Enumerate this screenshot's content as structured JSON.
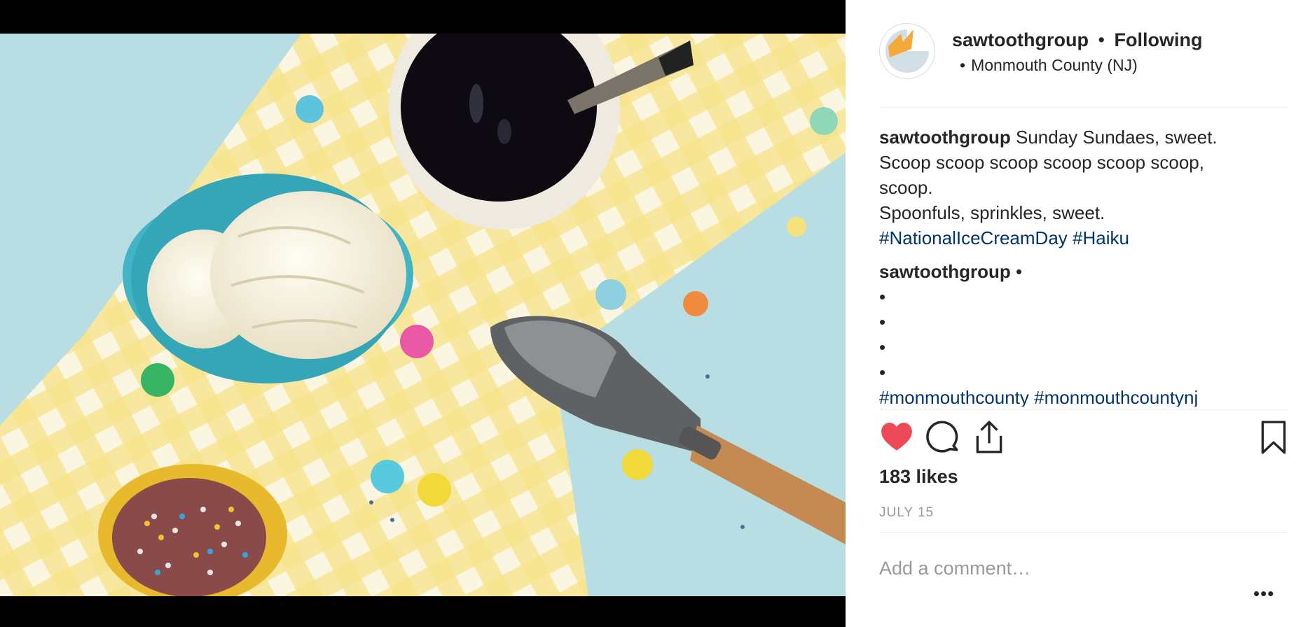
{
  "post": {
    "username": "sawtoothgroup",
    "separator": "•",
    "follow_status": "Following",
    "location_bullet": "•",
    "location": "Monmouth County (NJ)"
  },
  "caption": {
    "username": "sawtoothgroup",
    "lines": [
      "Sunday Sundaes, sweet.",
      "Scoop scoop scoop scoop scoop scoop,",
      "scoop.",
      "Spoonfuls, sprinkles, sweet."
    ],
    "hashtags": [
      "#NationalIceCreamDay",
      "#Haiku"
    ]
  },
  "second_comment": {
    "username": "sawtoothgroup",
    "suffix": "•",
    "bullets": [
      "•",
      "•",
      "•",
      "•"
    ],
    "hashtags": [
      "#monmouthcounty",
      "#monmouthcountynj"
    ]
  },
  "actions": {
    "icons": [
      "heart-filled-icon",
      "comment-bubble-icon",
      "share-upload-icon",
      "bookmark-icon"
    ],
    "liked_color": "#ed4956"
  },
  "likes": "183 likes",
  "date": "JULY 15",
  "comment_input": {
    "placeholder": "Add a comment…",
    "value": ""
  },
  "more_label": "•••",
  "colors": {
    "text": "#262626",
    "hashtag": "#003569",
    "muted": "#999999",
    "divider": "#efefef"
  }
}
